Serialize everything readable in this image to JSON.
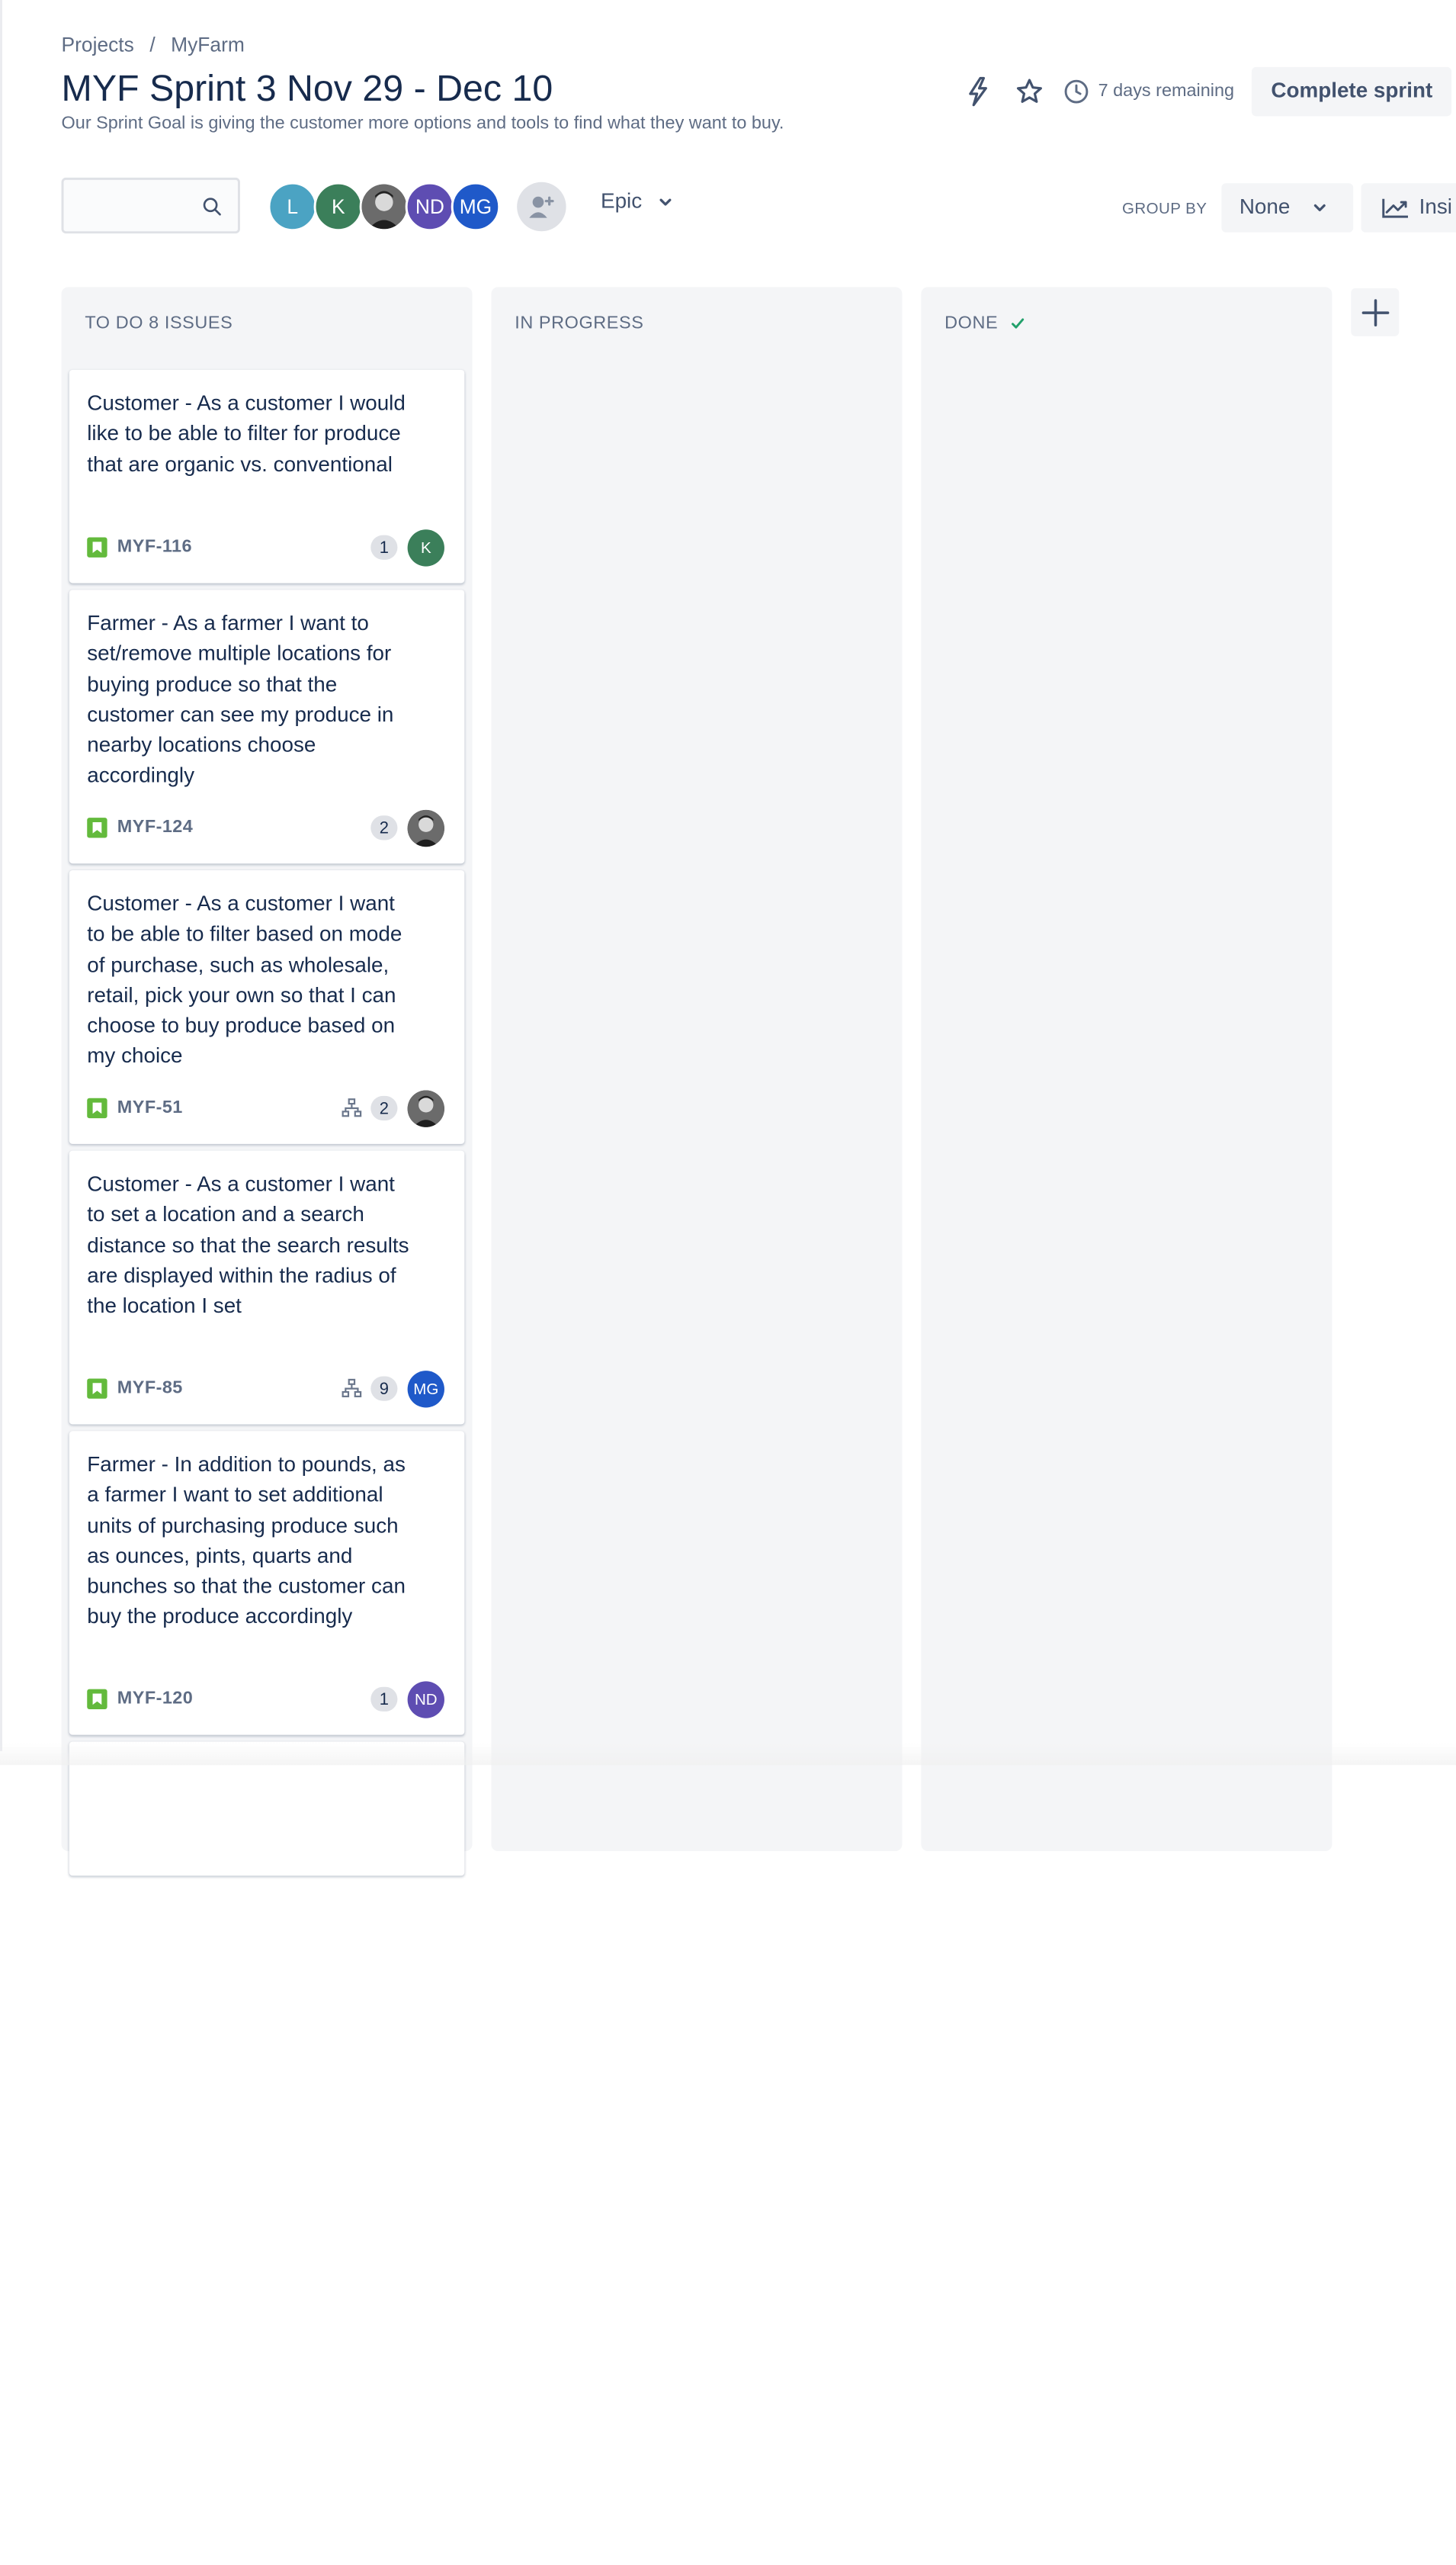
{
  "breadcrumb": {
    "projects": "Projects",
    "separator": "/",
    "project": "MyFarm"
  },
  "sprint": {
    "title": "MYF Sprint 3 Nov 29 - Dec 10",
    "goal": "Our Sprint Goal is giving the customer more options and tools to find what they want to buy.",
    "days_remaining": "7 days remaining",
    "complete_label": "Complete sprint"
  },
  "toolbar": {
    "search_value": "",
    "avatars": [
      {
        "initials": "L",
        "color": "#4ba3c3"
      },
      {
        "initials": "K",
        "color": "#3b7f5a"
      },
      {
        "initials": "",
        "color": "#3a3a3a"
      },
      {
        "initials": "ND",
        "color": "#5e4db2"
      },
      {
        "initials": "MG",
        "color": "#1f59c9"
      }
    ],
    "epic_label": "Epic",
    "group_by_label": "GROUP BY",
    "group_by_value": "None",
    "insights_label": "Insi"
  },
  "columns": {
    "todo": {
      "label": "TO DO 8 ISSUES"
    },
    "in_progress": {
      "label": "IN PROGRESS"
    },
    "done": {
      "label": "DONE"
    }
  },
  "cards": [
    {
      "text": "Customer - As a customer I would like to be able to filter for produce that are organic vs. conventional",
      "key": "MYF-116",
      "points": "1",
      "assignee": "K",
      "assignee_color": "#3b7f5a",
      "child_issues": false
    },
    {
      "text": "Farmer - As a farmer I want to set/remove multiple locations for buying produce so that the customer can see my produce in nearby locations choose accordingly",
      "key": "MYF-124",
      "points": "2",
      "assignee": "",
      "assignee_color": "#3a3a3a",
      "child_issues": false
    },
    {
      "text": "Customer - As a customer I want to be able to filter based on mode of purchase, such as wholesale, retail, pick your own so that I can choose to buy produce based on my choice",
      "key": "MYF-51",
      "points": "2",
      "assignee": "",
      "assignee_color": "#3a3a3a",
      "child_issues": true
    },
    {
      "text": "Customer - As a customer I want to set a location and a search distance so that the search results are displayed within the radius of the location I set",
      "key": "MYF-85",
      "points": "9",
      "assignee": "MG",
      "assignee_color": "#1f59c9",
      "child_issues": true
    },
    {
      "text": "Farmer - In addition to pounds, as a farmer I want to set additional units of purchasing produce such as ounces, pints, quarts and bunches so that the customer can buy the produce accordingly",
      "key": "MYF-120",
      "points": "1",
      "assignee": "ND",
      "assignee_color": "#5e4db2",
      "child_issues": false
    }
  ]
}
